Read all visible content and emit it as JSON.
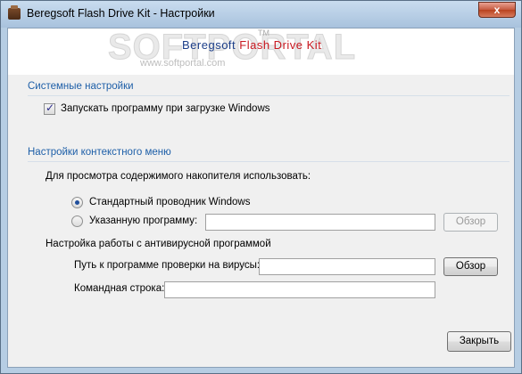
{
  "window": {
    "title": "Beregsoft Flash Drive Kit - Настройки",
    "close_label": "x"
  },
  "logo": {
    "watermark": "SOFTPORTAL",
    "watermark_tm": "TM",
    "watermark_url": "www.softportal.com",
    "name_part1": "Beregsoft",
    "name_part2": "Flash Drive Kit"
  },
  "system_settings": {
    "title": "Системные настройки",
    "autostart_label": "Запускать программу при загрузке Windows",
    "autostart_checked": true
  },
  "context_menu": {
    "title": "Настройки контекстного меню",
    "viewer_prompt": "Для просмотра содержимого накопителя использовать:",
    "option_explorer": "Стандартный проводник Windows",
    "option_custom": "Указанную программу:",
    "selected_option": "explorer",
    "custom_program_value": "",
    "browse_label": "Обзор"
  },
  "antivirus": {
    "title": "Настройка работы с антивирусной программой",
    "path_label": "Путь к программе проверки на вирусы:",
    "path_value": "",
    "browse_label": "Обзор",
    "cmdline_label": "Командная строка:",
    "cmdline_value": ""
  },
  "footer": {
    "close_label": "Закрыть"
  }
}
